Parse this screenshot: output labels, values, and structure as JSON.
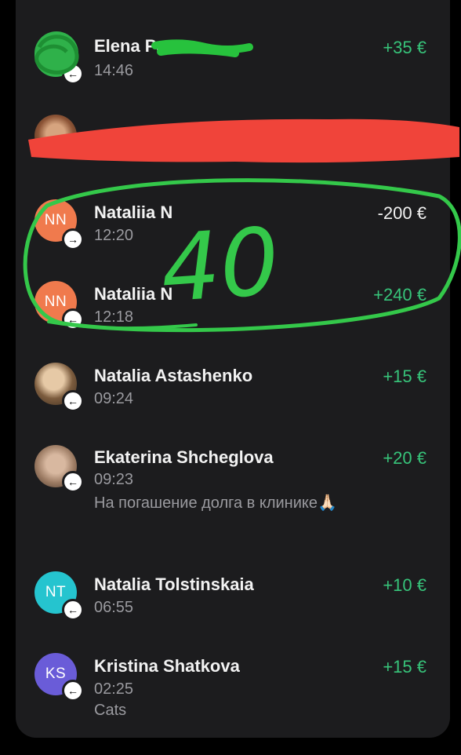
{
  "colors": {
    "positive": "#37c47a",
    "negative": "#f2f2f2",
    "annotation_green": "#34c84a",
    "redaction_red": "#f0443a"
  },
  "transactions": [
    {
      "avatar_initials": "",
      "name": "Elena Pa",
      "time": "14:46",
      "note": "",
      "amount": "+35 €",
      "direction_icon": "arrow-left-icon"
    },
    {
      "avatar_initials": "",
      "name": "",
      "time": "",
      "note": "",
      "amount": "",
      "direction_icon": ""
    },
    {
      "avatar_initials": "NN",
      "name": "Nataliia N",
      "time": "12:20",
      "note": "",
      "amount": "-200 €",
      "direction_icon": "arrow-right-icon"
    },
    {
      "avatar_initials": "NN",
      "name": "Nataliia N",
      "time": "12:18",
      "note": "",
      "amount": "+240 €",
      "direction_icon": "arrow-left-icon"
    },
    {
      "avatar_initials": "",
      "name": "Natalia Astashenko",
      "time": "09:24",
      "note": "",
      "amount": "+15 €",
      "direction_icon": "arrow-left-icon"
    },
    {
      "avatar_initials": "",
      "name": "Ekaterina Shcheglova",
      "time": "09:23",
      "note": "На погашение долга в клинике🙏🏻",
      "amount": "+20 €",
      "direction_icon": "arrow-left-icon"
    },
    {
      "avatar_initials": "NT",
      "name": "Natalia Tolstinskaia",
      "time": "06:55",
      "note": "",
      "amount": "+10 €",
      "direction_icon": "arrow-left-icon"
    },
    {
      "avatar_initials": "KS",
      "name": "Kristina Shatkova",
      "time": "02:25",
      "note": "Cats",
      "amount": "+15 €",
      "direction_icon": "arrow-left-icon"
    }
  ],
  "annotation": {
    "text": "40"
  }
}
